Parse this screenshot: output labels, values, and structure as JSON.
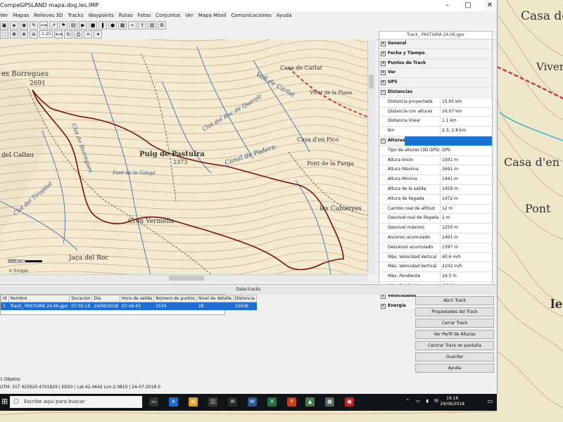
{
  "window": {
    "title": "CompeGPSLAND mapa.dog.les.IMP",
    "minimize": "–",
    "maximize": "□",
    "close": "✕"
  },
  "menu": [
    "Ver",
    "Mapas",
    "Relieves 3D",
    "Tracks",
    "Waypoints",
    "Rutas",
    "Fotos",
    "Conjuntos",
    "Ver",
    "Mapa Móvil",
    "Comunicaciones",
    "Ayuda"
  ],
  "toolbar": {
    "zoom_value": "1:25"
  },
  "map": {
    "labels": [
      {
        "text": "es Borregues",
        "kind": "peak"
      },
      {
        "text": "2691",
        "kind": "peak"
      },
      {
        "text": "Puig de Pastuira",
        "kind": "peak"
      },
      {
        "text": "2373",
        "kind": "peak"
      },
      {
        "text": "Casa de Carlat",
        "kind": "place"
      },
      {
        "text": "Casa d'en Pico",
        "kind": "place"
      },
      {
        "text": "Pont de la Farga",
        "kind": "place"
      },
      {
        "text": "les Cabanyes",
        "kind": "place"
      },
      {
        "text": "Cren Vermella",
        "kind": "place"
      },
      {
        "text": "Jaça del Roc",
        "kind": "place"
      },
      {
        "text": "del Callau",
        "kind": "place"
      },
      {
        "text": "Canal de Padern",
        "kind": "water"
      },
      {
        "text": "Clot del Roc de Queralt",
        "kind": "water"
      },
      {
        "text": "Font de la Ganga",
        "kind": "water"
      },
      {
        "text": "Clot del Tirapitol",
        "kind": "water"
      },
      {
        "text": "Clot de Borregues",
        "kind": "water"
      },
      {
        "text": "Vall de Carlat",
        "kind": "water"
      },
      {
        "text": "Viver de la Plana",
        "kind": "place"
      }
    ],
    "scale_label": "500 m",
    "attribution": "© Emipix"
  },
  "background_map_labels": [
    "Casa de Carlat",
    "Viver de la Pla",
    "Casa d'en",
    "Pont",
    "le"
  ],
  "panel": {
    "title": "Track_ PASTUIRA 24.06.gpx",
    "rows": [
      {
        "type": "cat",
        "k": "General",
        "v": "",
        "toggle": "+"
      },
      {
        "type": "cat",
        "k": "Fecha y Tiempo",
        "v": "",
        "toggle": "+"
      },
      {
        "type": "cat",
        "k": "Puntos de Track",
        "v": "",
        "toggle": "+"
      },
      {
        "type": "cat",
        "k": "Ver",
        "v": "",
        "toggle": "+"
      },
      {
        "type": "cat",
        "k": "GPS",
        "v": "",
        "toggle": "+"
      },
      {
        "type": "cat",
        "k": "Distancias",
        "v": "",
        "toggle": "−"
      },
      {
        "type": "row",
        "k": "Distancia proyectada",
        "v": "15.65 km"
      },
      {
        "type": "row",
        "k": "Distancia con alturas",
        "v": "16.07 km"
      },
      {
        "type": "row",
        "k": "Distancia lineal",
        "v": "1.1 km"
      },
      {
        "type": "row",
        "k": "Km",
        "v": "2.3, 2.8 km"
      },
      {
        "type": "cat",
        "k": "Alturas",
        "v": "",
        "toggle": "−",
        "selected": true
      },
      {
        "type": "row",
        "k": "Tipo de alturas (3D GPS)",
        "v": "GPS"
      },
      {
        "type": "row",
        "k": "Altura Inicio",
        "v": "1501 m"
      },
      {
        "type": "row",
        "k": "Altura Máxima",
        "v": "2691 m"
      },
      {
        "type": "row",
        "k": "Altura Mínima",
        "v": "1441 m"
      },
      {
        "type": "row",
        "k": "Altura de la salida",
        "v": "1459 m"
      },
      {
        "type": "row",
        "k": "Altura de llegada",
        "v": "1472 m"
      },
      {
        "type": "row",
        "k": "Cambio real de altitud",
        "v": "12 m"
      },
      {
        "type": "row",
        "k": "Desnivel real de llegada",
        "v": "2 m"
      },
      {
        "type": "row",
        "k": "Desnivel máximo",
        "v": "1250 m"
      },
      {
        "type": "row",
        "k": "Ascenso acumulado",
        "v": "1401 m"
      },
      {
        "type": "row",
        "k": "Descenso acumulado",
        "v": "1397 m"
      },
      {
        "type": "row",
        "k": "Máx. Velocidad Vertical",
        "v": "40.6 m/h"
      },
      {
        "type": "row",
        "k": "Máx. Velocidad Vertical",
        "v": "2102 m/h"
      },
      {
        "type": "row",
        "k": "Máx. Pendiente",
        "v": "16.3 %"
      },
      {
        "type": "row",
        "k": "Máx. Pendiente",
        "v": "-13.6 %"
      },
      {
        "type": "cat",
        "k": "Velocidades",
        "v": "",
        "toggle": "+"
      },
      {
        "type": "cat",
        "k": "Energía",
        "v": "",
        "toggle": "+"
      }
    ]
  },
  "tab_label": "Data tracks",
  "tracklist": {
    "headers": [
      "Id",
      "Nombre",
      "Duración",
      "Día",
      "Hora de salida",
      "Número de puntos",
      "Nivel de detalle",
      "Distancia"
    ],
    "rows": [
      [
        "1",
        "Track_ PASTUIRA 24.06.gpx",
        "07:05:19",
        "24/06/2018",
        "07:46:43",
        "1534",
        "28",
        "15636"
      ]
    ]
  },
  "actions": [
    "Abrir Track",
    "Propiedades del Track",
    "Cerrar Track",
    "Ver Perfil de Alturas",
    "Centrar Track en pantalla",
    "Guardar",
    "Ayuda"
  ],
  "status": {
    "line1": "1 Objetos",
    "line2": "UTM: 31T 425920 4701829 | ED50 | Lat:42.4642 Lon:2.0815 | 24-07-2018 0"
  },
  "taskbar": {
    "search_placeholder": "Escribe aquí para buscar",
    "time": "19:16",
    "date": "24/06/2018",
    "tray": "⌃ ▭ ◖ ✉"
  },
  "colors": {
    "track": "#7a0d10",
    "contour": "#c9a58a",
    "water": "#3d6fb3",
    "selection": "#1e6fd3"
  }
}
